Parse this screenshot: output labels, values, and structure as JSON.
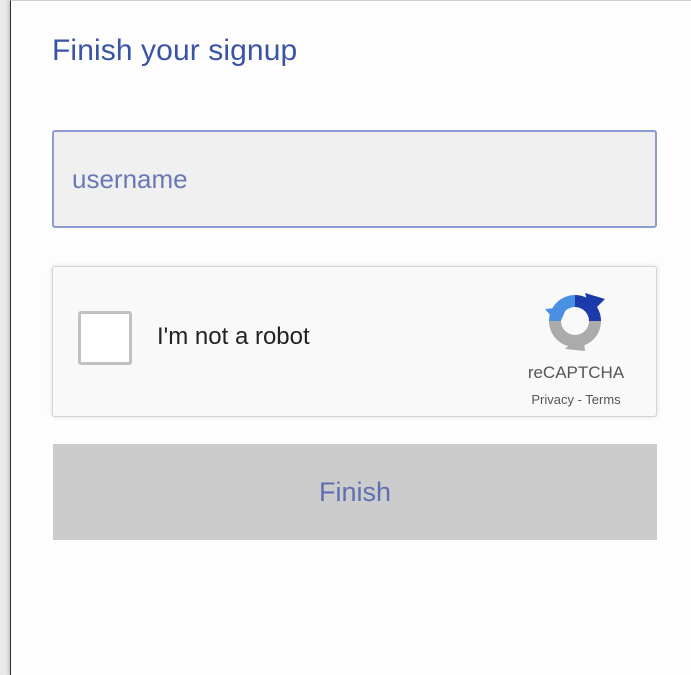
{
  "form": {
    "title": "Finish your signup",
    "username": {
      "placeholder": "username",
      "value": ""
    },
    "recaptcha": {
      "checkbox_label": "I'm not a robot",
      "checked": false,
      "brand": "reCAPTCHA",
      "privacy_link": "Privacy",
      "separator": " - ",
      "terms_link": "Terms",
      "logo_icon": "recaptcha-logo-icon"
    },
    "finish_button_label": "Finish"
  },
  "colors": {
    "title": "#3a53a4",
    "input_border": "#8e9bd3",
    "input_background": "#f0f0f0",
    "placeholder": "#6a78b8",
    "button_background": "#cccccc",
    "button_text": "#5f6fb3"
  }
}
